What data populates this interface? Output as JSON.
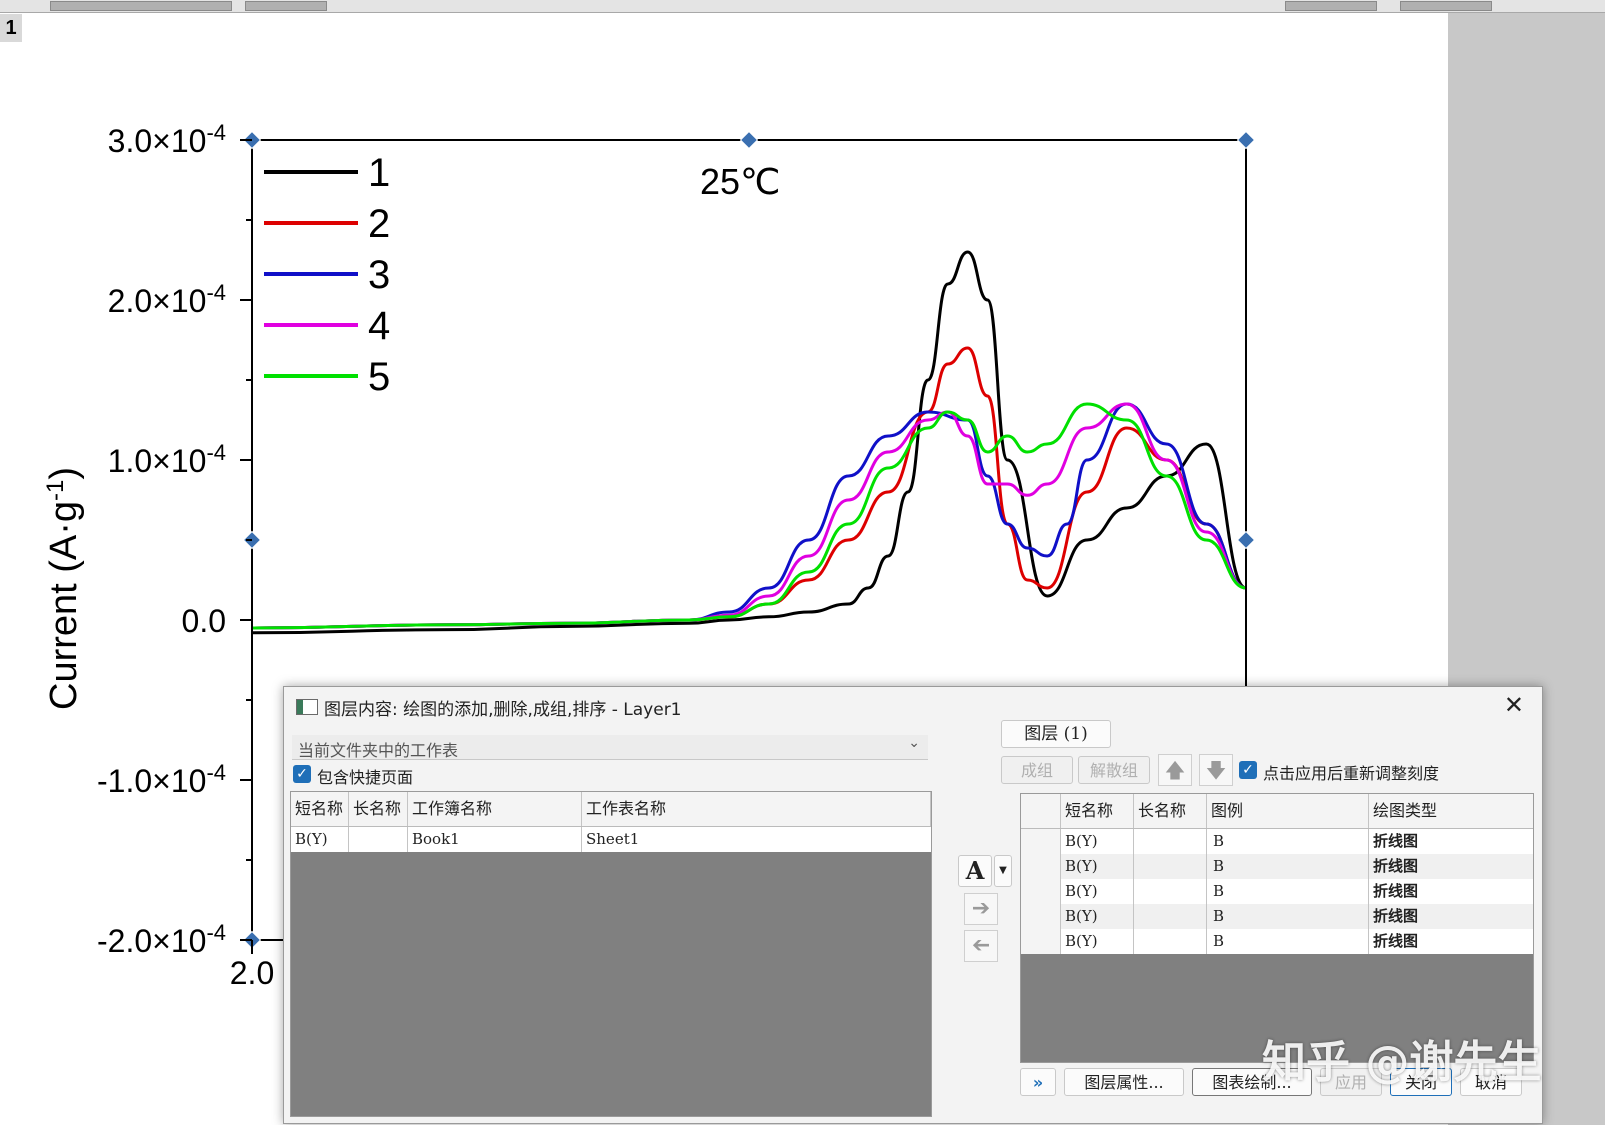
{
  "page": {
    "number": "1"
  },
  "chart_data": {
    "type": "line",
    "annotation": "25℃",
    "xlabel": "",
    "ylabel_main": "Current (A·g",
    "ylabel_sup": "-1",
    "ylabel_end": ")",
    "xticks": [
      {
        "label": "2.0"
      }
    ],
    "yticks": [
      {
        "value": 0.0003,
        "label": "3.0×10",
        "exp": "-4"
      },
      {
        "value": 0.0002,
        "label": "2.0×10",
        "exp": "-4"
      },
      {
        "value": 0.0001,
        "label": "1.0×10",
        "exp": "-4"
      },
      {
        "value": 0,
        "label": "0.0",
        "exp": ""
      },
      {
        "value": -0.0001,
        "label": "-1.0×10",
        "exp": "-4"
      },
      {
        "value": -0.0002,
        "label": "-2.0×10",
        "exp": "-4"
      }
    ],
    "ylim": [
      -0.0002,
      0.0003
    ],
    "xlim": [
      2.0,
      4.5
    ],
    "legend_position": "top-left",
    "series": [
      {
        "name": "1",
        "color": "#000000",
        "x": [
          2.0,
          2.5,
          2.8,
          3.1,
          3.2,
          3.3,
          3.4,
          3.5,
          3.55,
          3.6,
          3.65,
          3.7,
          3.75,
          3.8,
          3.85,
          3.9,
          4.0,
          4.1,
          4.2,
          4.3,
          4.4,
          4.5
        ],
        "y": [
          -8e-06,
          -6e-06,
          -4e-06,
          -2e-06,
          0,
          2e-06,
          5e-06,
          1e-05,
          2e-05,
          4e-05,
          8e-05,
          0.00015,
          0.00021,
          0.00023,
          0.0002,
          0.0001,
          1.5e-05,
          5e-05,
          7e-05,
          9e-05,
          0.00011,
          2e-05
        ]
      },
      {
        "name": "2",
        "color": "#dd0000",
        "x": [
          2.0,
          2.5,
          2.8,
          3.1,
          3.2,
          3.3,
          3.4,
          3.5,
          3.6,
          3.7,
          3.75,
          3.8,
          3.85,
          3.9,
          3.95,
          4.0,
          4.1,
          4.2,
          4.3,
          4.4,
          4.5
        ],
        "y": [
          -5e-06,
          -3e-06,
          -2e-06,
          0,
          2e-06,
          1e-05,
          2.5e-05,
          5e-05,
          8e-05,
          0.00013,
          0.00016,
          0.00017,
          0.00014,
          6e-05,
          2.5e-05,
          2e-05,
          8e-05,
          0.00012,
          0.0001,
          6e-05,
          2e-05
        ]
      },
      {
        "name": "3",
        "color": "#1010c8",
        "x": [
          2.0,
          2.5,
          2.8,
          3.1,
          3.2,
          3.3,
          3.4,
          3.5,
          3.6,
          3.7,
          3.8,
          3.85,
          3.9,
          3.95,
          4.0,
          4.05,
          4.1,
          4.2,
          4.3,
          4.4,
          4.5
        ],
        "y": [
          -5e-06,
          -3e-06,
          -2e-06,
          0,
          5e-06,
          2e-05,
          5e-05,
          9e-05,
          0.000115,
          0.00013,
          0.000125,
          9e-05,
          6e-05,
          4.5e-05,
          4e-05,
          6e-05,
          0.0001,
          0.000135,
          0.00011,
          6e-05,
          2e-05
        ]
      },
      {
        "name": "4",
        "color": "#e000e0",
        "x": [
          2.0,
          2.5,
          2.8,
          3.1,
          3.2,
          3.3,
          3.4,
          3.5,
          3.6,
          3.7,
          3.75,
          3.8,
          3.85,
          3.9,
          3.95,
          4.0,
          4.1,
          4.2,
          4.3,
          4.4,
          4.5
        ],
        "y": [
          -5e-06,
          -3e-06,
          -2e-06,
          0,
          3e-06,
          1.5e-05,
          4e-05,
          7.5e-05,
          0.000105,
          0.000125,
          0.00013,
          0.000115,
          8.5e-05,
          8.5e-05,
          7.8e-05,
          8.5e-05,
          0.00012,
          0.000135,
          0.0001,
          5.5e-05,
          2e-05
        ]
      },
      {
        "name": "5",
        "color": "#00e000",
        "x": [
          2.0,
          2.5,
          2.8,
          3.1,
          3.2,
          3.3,
          3.4,
          3.5,
          3.6,
          3.7,
          3.75,
          3.8,
          3.85,
          3.9,
          3.95,
          4.0,
          4.1,
          4.2,
          4.3,
          4.4,
          4.5
        ],
        "y": [
          -5e-06,
          -3e-06,
          -2e-06,
          0,
          2e-06,
          1e-05,
          3e-05,
          6e-05,
          9.5e-05,
          0.00012,
          0.00013,
          0.000125,
          0.000105,
          0.000115,
          0.000105,
          0.00011,
          0.000135,
          0.000125,
          9e-05,
          5e-05,
          2e-05
        ]
      }
    ]
  },
  "dialog": {
    "title": "图层内容: 绘图的添加,删除,成组,排序 - Layer1",
    "source_combo": "当前文件夹中的工作表",
    "include_shortcuts_label": "包含快捷页面",
    "left_columns": [
      "短名称",
      "长名称",
      "工作簿名称",
      "工作表名称"
    ],
    "left_rows": [
      [
        "B(Y)",
        "",
        "Book1",
        "Sheet1"
      ]
    ],
    "layer_tab": "图层 (1)",
    "group_button": "成组",
    "ungroup_button": "解散组",
    "rescale_label": "点击应用后重新调整刻度",
    "right_columns": [
      "短名称",
      "长名称",
      "图例",
      "绘图类型"
    ],
    "right_rows": [
      [
        "B(Y)",
        "",
        "B",
        "折线图"
      ],
      [
        "B(Y)",
        "",
        "B",
        "折线图"
      ],
      [
        "B(Y)",
        "",
        "B",
        "折线图"
      ],
      [
        "B(Y)",
        "",
        "B",
        "折线图"
      ],
      [
        "B(Y)",
        "",
        "B",
        "折线图"
      ]
    ],
    "more_button": "»",
    "layer_props_button": "图层属性...",
    "plot_setup_button": "图表绘制...",
    "apply_button": "应用",
    "close_button": "关闭",
    "cancel_button": "取消"
  },
  "watermark": "知乎 @谢先生"
}
